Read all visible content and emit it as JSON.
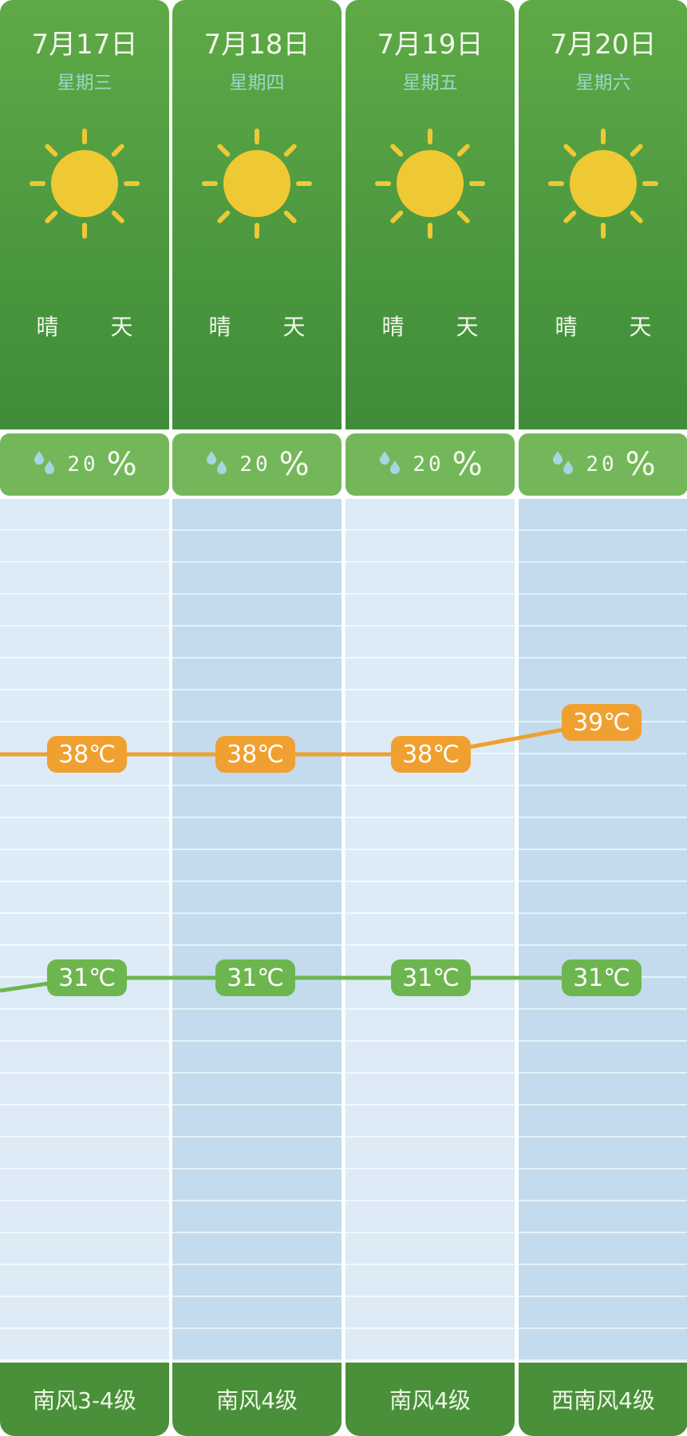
{
  "days": [
    {
      "date": "7月17日",
      "weekday": "星期三",
      "condition": "晴 天",
      "icon": "sun-icon",
      "rain_value": "20",
      "rain_unit": "%",
      "high": "38℃",
      "low": "31℃",
      "wind": "南风3-4级"
    },
    {
      "date": "7月18日",
      "weekday": "星期四",
      "condition": "晴 天",
      "icon": "sun-icon",
      "rain_value": "20",
      "rain_unit": "%",
      "high": "38℃",
      "low": "31℃",
      "wind": "南风4级"
    },
    {
      "date": "7月19日",
      "weekday": "星期五",
      "condition": "晴 天",
      "icon": "sun-icon",
      "rain_value": "20",
      "rain_unit": "%",
      "high": "38℃",
      "low": "31℃",
      "wind": "南风4级"
    },
    {
      "date": "7月20日",
      "weekday": "星期六",
      "condition": "晴 天",
      "icon": "sun-icon",
      "rain_value": "20",
      "rain_unit": "%",
      "high": "39℃",
      "low": "31℃",
      "wind": "西南风4级"
    }
  ],
  "chart_data": {
    "type": "line",
    "categories": [
      "7月17日",
      "7月18日",
      "7月19日",
      "7月20日"
    ],
    "series": [
      {
        "values": [
          38,
          38,
          38,
          39
        ],
        "color": "#f0a030"
      },
      {
        "values": [
          31,
          31,
          31,
          31
        ],
        "color": "#6db64f"
      }
    ],
    "unit": "℃"
  },
  "colors": {
    "header_green": "#4f9a40",
    "rain_green": "#74b75a",
    "sun": "#eec934",
    "high": "#f0a030",
    "low": "#6db64f"
  }
}
